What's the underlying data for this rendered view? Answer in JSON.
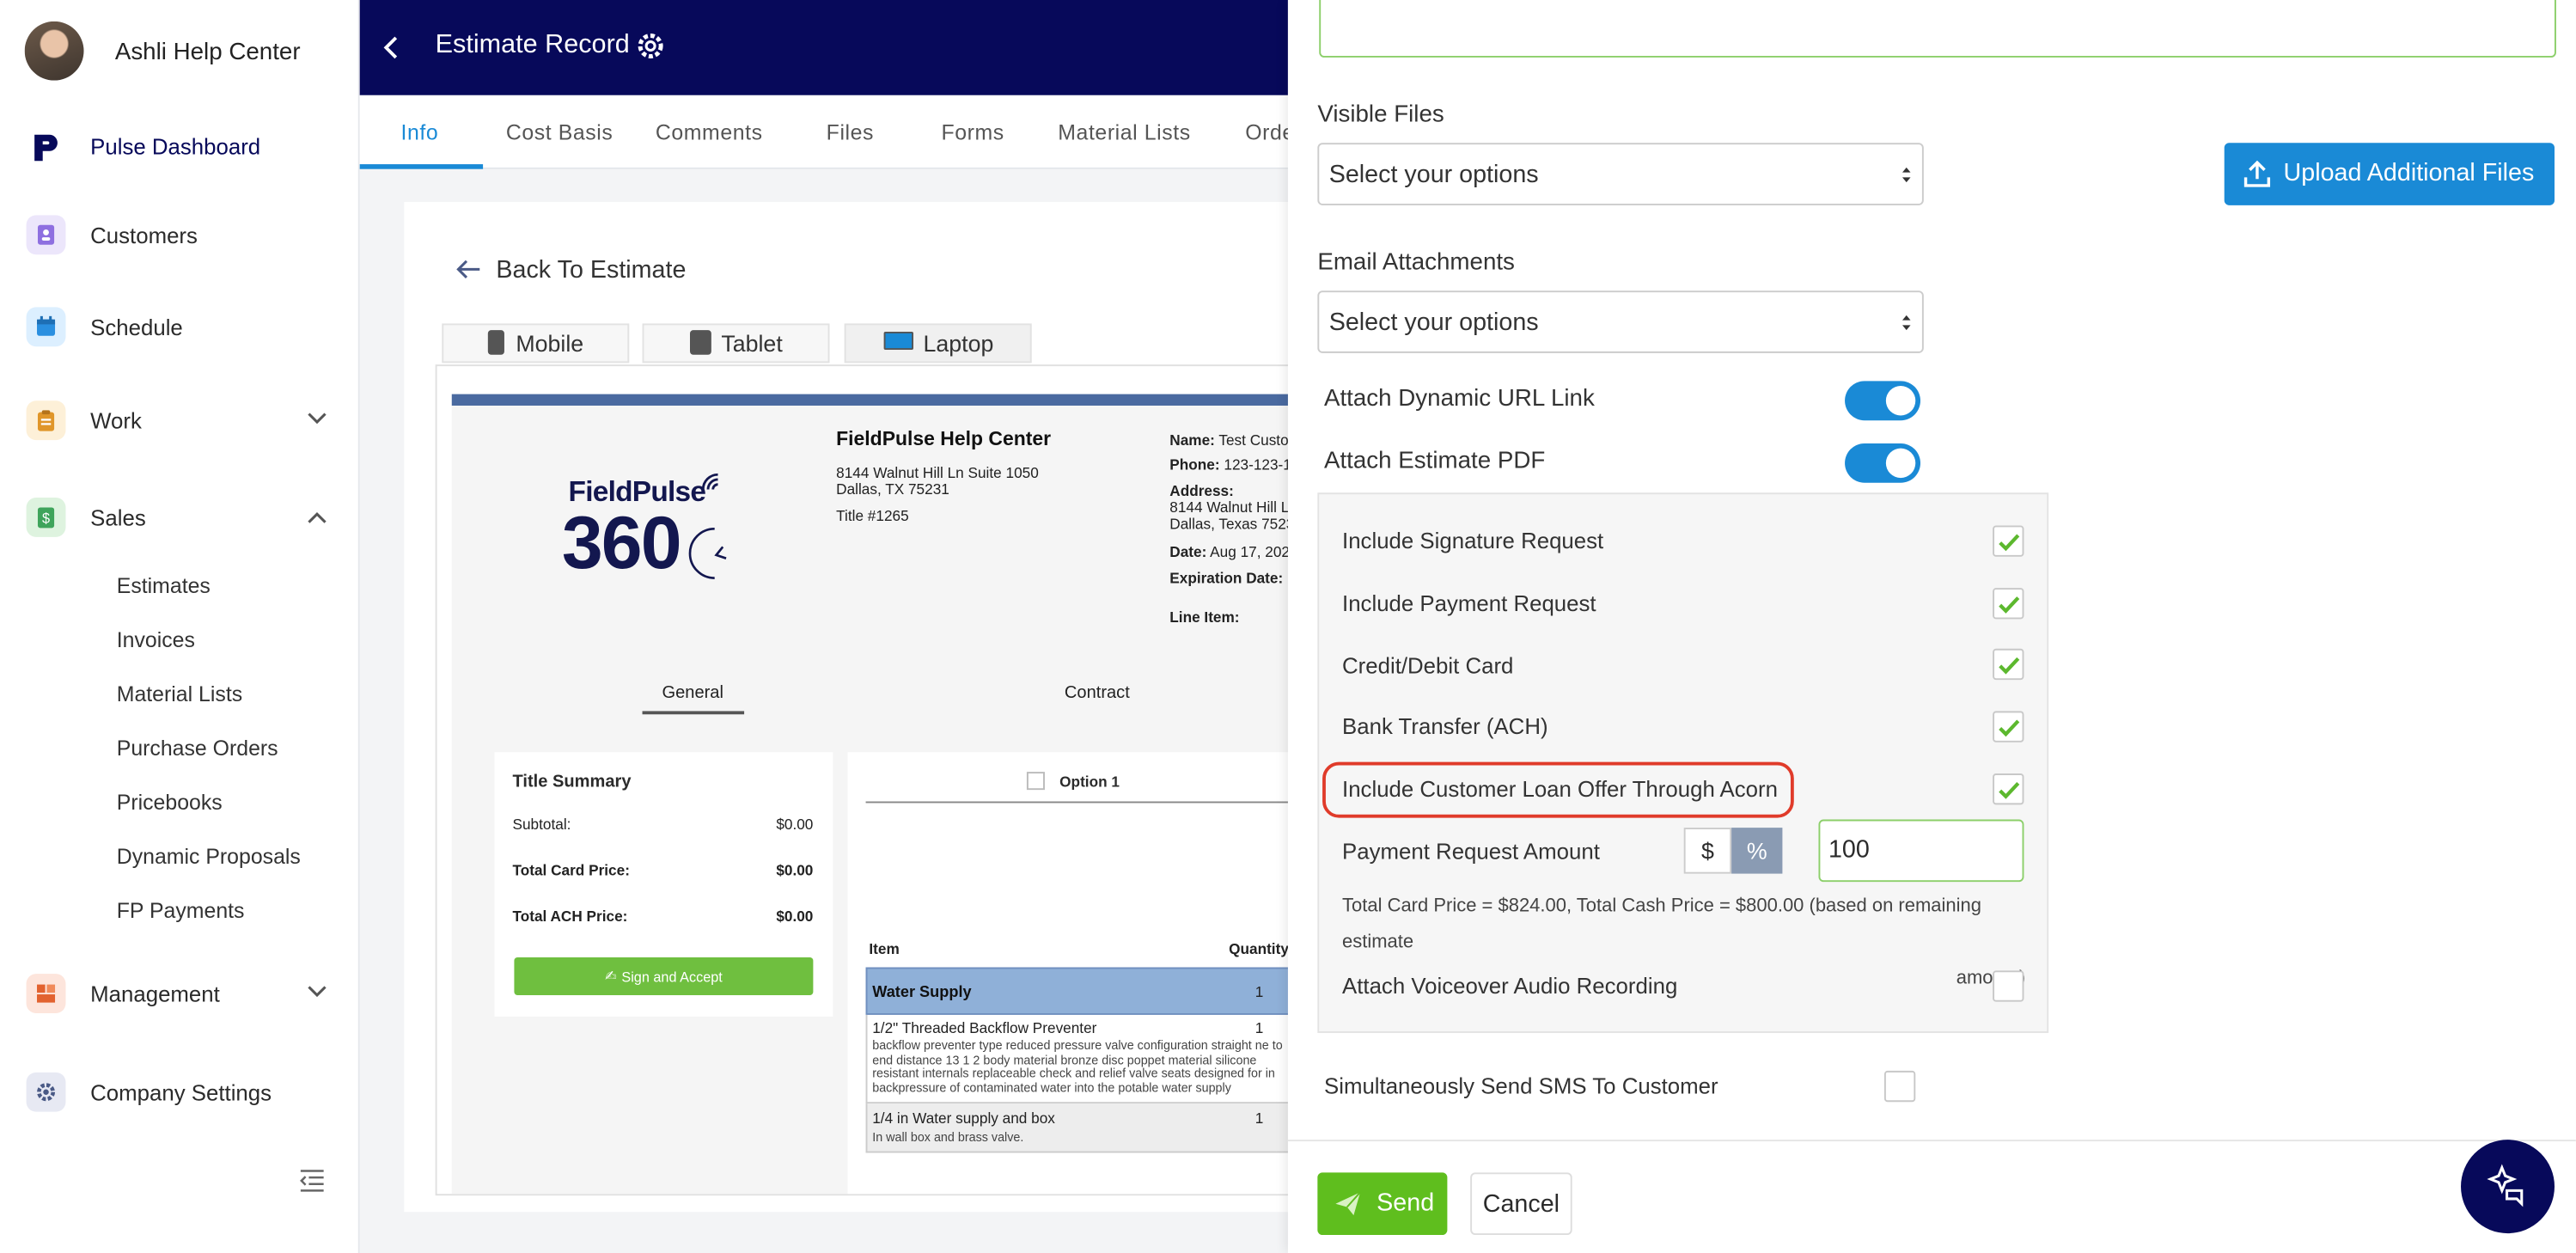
{
  "sidebar": {
    "account_name": "Ashli Help Center",
    "items": [
      {
        "label": "Pulse Dashboard",
        "icon": "pulse-logo-icon"
      },
      {
        "label": "Customers",
        "icon": "customers-icon"
      },
      {
        "label": "Schedule",
        "icon": "calendar-icon"
      },
      {
        "label": "Work",
        "icon": "clipboard-icon"
      },
      {
        "label": "Sales",
        "icon": "dollar-doc-icon"
      },
      {
        "label": "Management",
        "icon": "management-icon"
      },
      {
        "label": "Company Settings",
        "icon": "gear-icon"
      }
    ],
    "sales_subitems": [
      "Estimates",
      "Invoices",
      "Material Lists",
      "Purchase Orders",
      "Pricebooks",
      "Dynamic Proposals",
      "FP Payments"
    ]
  },
  "header": {
    "title": "Estimate Record"
  },
  "tabs": [
    "Info",
    "Cost Basis",
    "Comments",
    "Files",
    "Forms",
    "Material Lists",
    "Orde"
  ],
  "preview": {
    "back_label": "Back To Estimate",
    "devices": [
      "Mobile",
      "Tablet",
      "Laptop"
    ],
    "logo_text": "FieldPulse",
    "logo_number": "360",
    "company": "FieldPulse Help Center",
    "address1": "8144 Walnut Hill Ln Suite 1050",
    "address2": "Dallas, TX 75231",
    "title_num": "Title #1265",
    "meta": {
      "name_k": "Name:",
      "name_v": "Test Custo",
      "phone_k": "Phone:",
      "phone_v": "123-123-1",
      "address_k": "Address:",
      "address_v1": "8144 Walnut Hill L",
      "address_v2": "Dallas, Texas 7523",
      "date_k": "Date:",
      "date_v": "Aug 17, 202",
      "exp_k": "Expiration Date:",
      "line_k": "Line Item:"
    },
    "subtabs": [
      "General",
      "Contract"
    ],
    "summary": {
      "title": "Title Summary",
      "rows": [
        {
          "k": "Subtotal:",
          "v": "$0.00"
        },
        {
          "k": "Total Card Price:",
          "v": "$0.00"
        },
        {
          "k": "Total ACH Price:",
          "v": "$0.00"
        }
      ],
      "sign_button": "Sign and Accept"
    },
    "option_label": "Option 1",
    "table": {
      "col_item": "Item",
      "col_qty": "Quantity",
      "group": "Water Supply",
      "group_qty": "1",
      "row1_name": "1/2\" Threaded Backflow Preventer",
      "row1_qty": "1",
      "row1_desc": "backflow preventer type reduced pressure valve configuration straight ne to end distance 13 1 2 body material bronze disc poppet material silicone resistant internals replaceable check and relief valve seats designed for in backpressure of contaminated water into the potable water supply",
      "row2_name": "1/4 in Water supply and box",
      "row2_qty": "1",
      "row2_desc": "In wall box and brass valve."
    }
  },
  "panel": {
    "visible_files_label": "Visible Files",
    "visible_files_placeholder": "Select your options",
    "upload_button": "Upload Additional Files",
    "email_attach_label": "Email Attachments",
    "email_attach_placeholder": "Select your options",
    "attach_url_label": "Attach Dynamic URL Link",
    "attach_url_on": true,
    "attach_pdf_label": "Attach Estimate PDF",
    "attach_pdf_on": true,
    "options": [
      {
        "label": "Include Signature Request",
        "checked": true
      },
      {
        "label": "Include Payment Request",
        "checked": true
      },
      {
        "label": "Credit/Debit Card",
        "checked": true
      },
      {
        "label": "Bank Transfer (ACH)",
        "checked": true
      },
      {
        "label": "Include Customer Loan Offer Through Acorn",
        "checked": true
      }
    ],
    "payment_amount_label": "Payment Request Amount",
    "currency_symbol": "$",
    "percent_symbol": "%",
    "payment_amount_value": "100",
    "totals_note_line1": "Total Card Price = $824.00, Total Cash Price = $800.00 (based on remaining estimate",
    "totals_note_line2": "amount)",
    "voiceover_label": "Attach Voiceover Audio Recording",
    "voiceover_checked": false,
    "sms_label": "Simultaneously Send SMS To Customer",
    "sms_checked": false,
    "send_button": "Send",
    "cancel_button": "Cancel"
  },
  "colors": {
    "nav": "#07095a",
    "accent": "#1a8ad6",
    "check": "#5cb85c",
    "send": "#5fbe1e",
    "highlight": "#e03b2a"
  }
}
